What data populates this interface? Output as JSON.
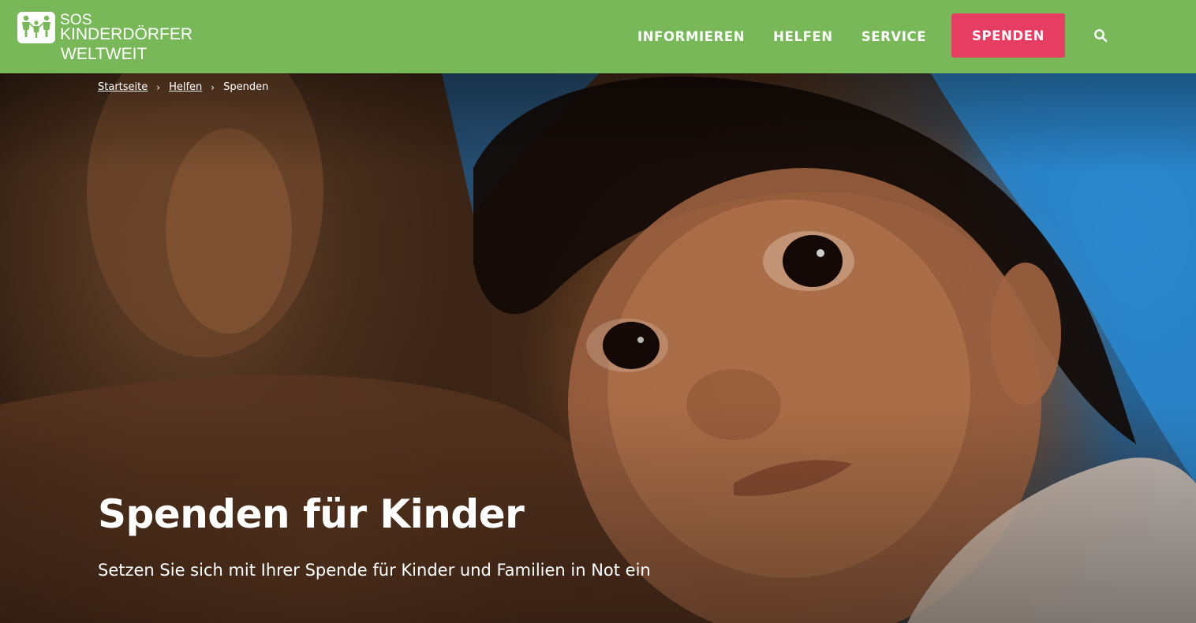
{
  "header": {
    "logo": {
      "line1": "SOS",
      "line2": "KINDERDÖRFER",
      "line3": "WELTWEIT"
    },
    "nav": [
      {
        "label": "INFORMIEREN"
      },
      {
        "label": "HELFEN"
      },
      {
        "label": "SERVICE"
      }
    ],
    "donate_label": "SPENDEN",
    "search_icon": "search-icon"
  },
  "breadcrumb": [
    {
      "label": "Startseite",
      "link": true
    },
    {
      "label": "Helfen",
      "link": true
    },
    {
      "label": "Spenden",
      "link": false
    }
  ],
  "hero": {
    "title": "Spenden für Kinder",
    "subtitle": "Setzen Sie sich mit Ihrer Spende für Kinder und Familien in Not ein",
    "image": "photo of a young child resting on an adult's shoulder"
  },
  "colors": {
    "header_bg": "#79b859",
    "donate_bg": "#e63d62",
    "text": "#ffffff"
  }
}
